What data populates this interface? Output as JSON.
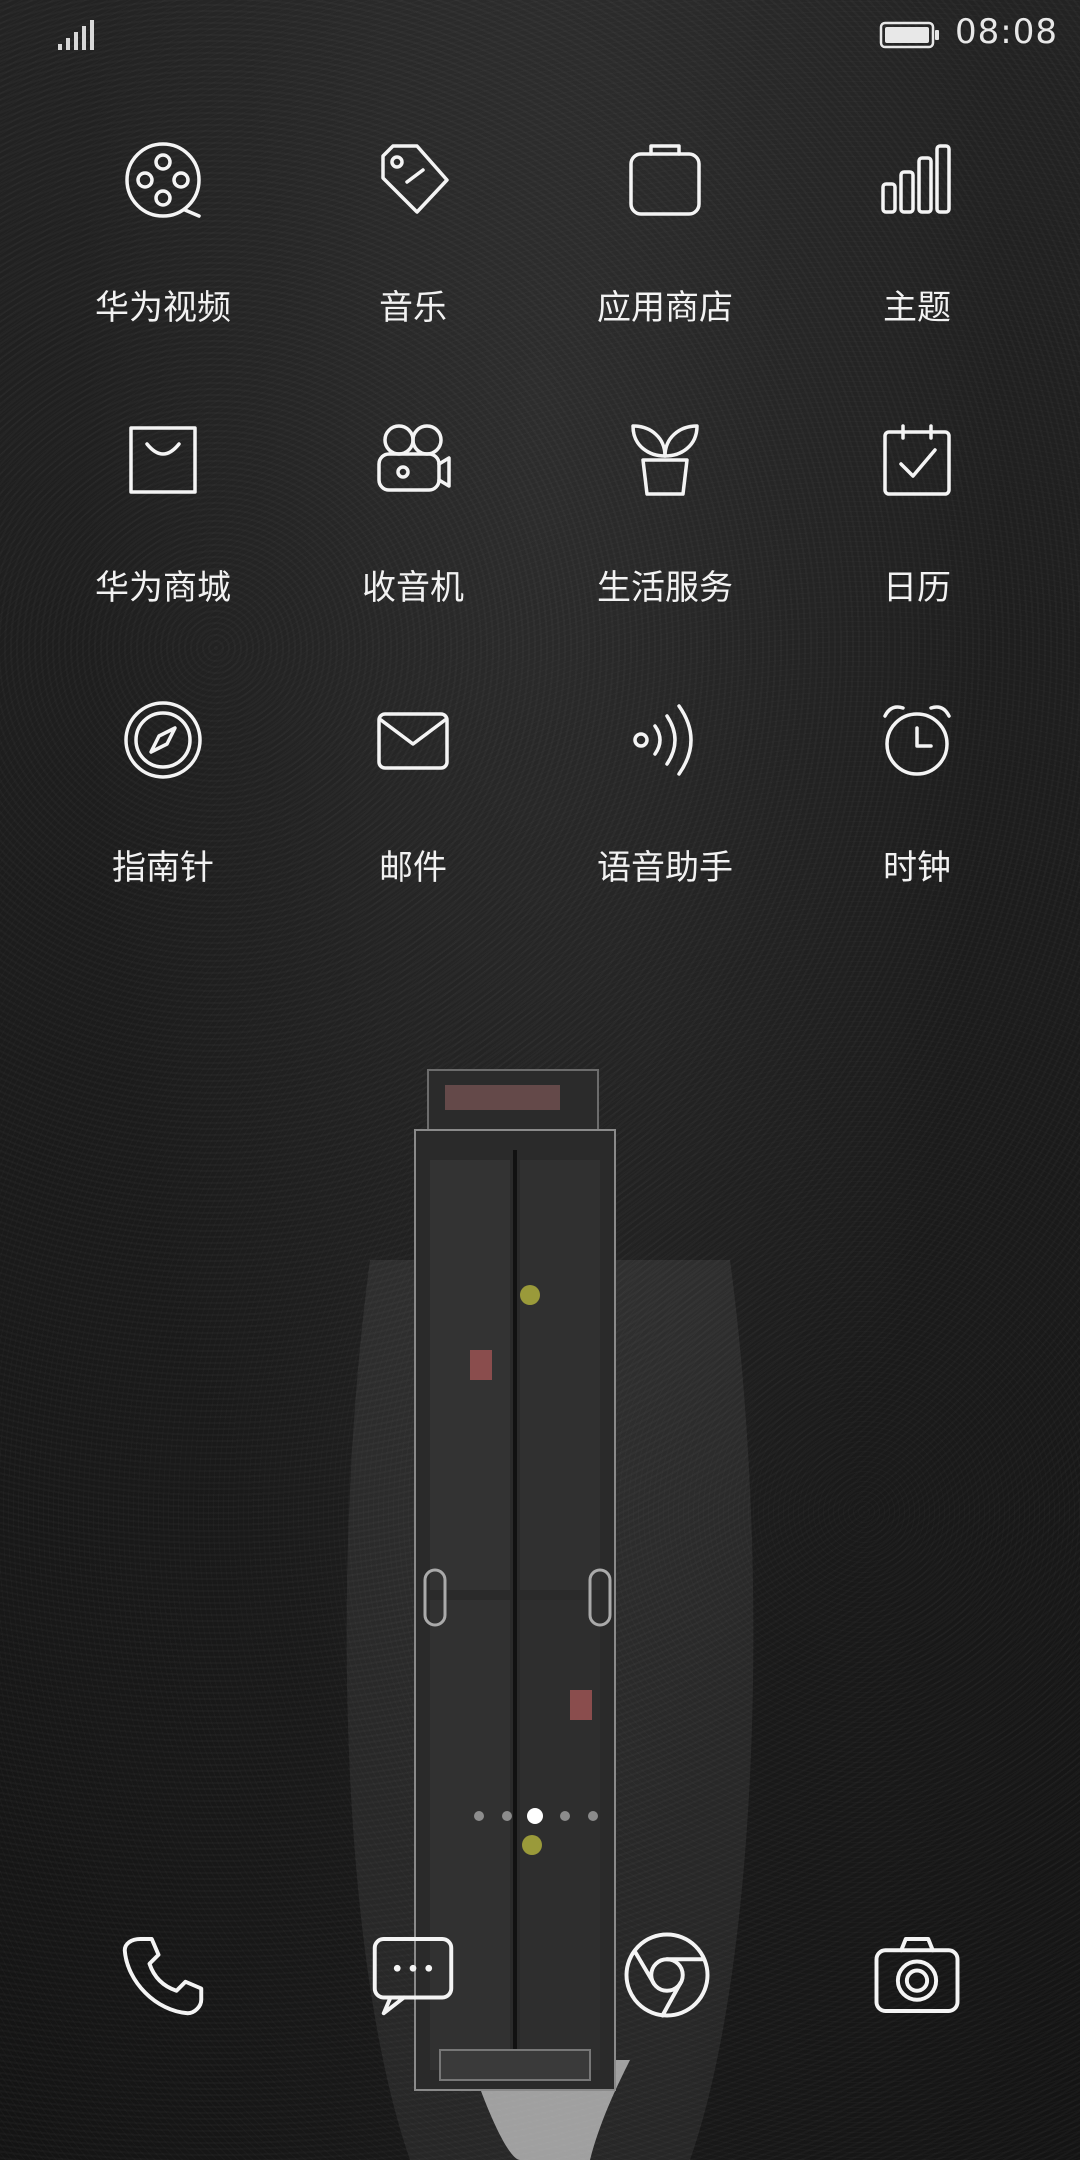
{
  "status_bar": {
    "time": "08:08",
    "signal_icon": "signal-icon",
    "battery_icon": "battery-icon"
  },
  "apps": [
    {
      "label": "华为视频",
      "icon": "video-icon"
    },
    {
      "label": "音乐",
      "icon": "music-tag-icon"
    },
    {
      "label": "应用商店",
      "icon": "app-store-icon"
    },
    {
      "label": "主题",
      "icon": "themes-icon"
    },
    {
      "label": "华为商城",
      "icon": "shopping-bag-icon"
    },
    {
      "label": "收音机",
      "icon": "radio-icon"
    },
    {
      "label": "生活服务",
      "icon": "plant-icon"
    },
    {
      "label": "日历",
      "icon": "calendar-icon"
    },
    {
      "label": "指南针",
      "icon": "compass-icon"
    },
    {
      "label": "邮件",
      "icon": "mail-icon"
    },
    {
      "label": "语音助手",
      "icon": "voice-assistant-icon"
    },
    {
      "label": "时钟",
      "icon": "alarm-clock-icon"
    }
  ],
  "page_indicator": {
    "pages": 5,
    "active_index": 2
  },
  "dock": [
    {
      "icon": "phone-icon"
    },
    {
      "icon": "messages-icon"
    },
    {
      "icon": "browser-icon"
    },
    {
      "icon": "camera-icon"
    }
  ],
  "colors": {
    "foreground": "#f4f4f4",
    "background": "#1f1f1f"
  }
}
